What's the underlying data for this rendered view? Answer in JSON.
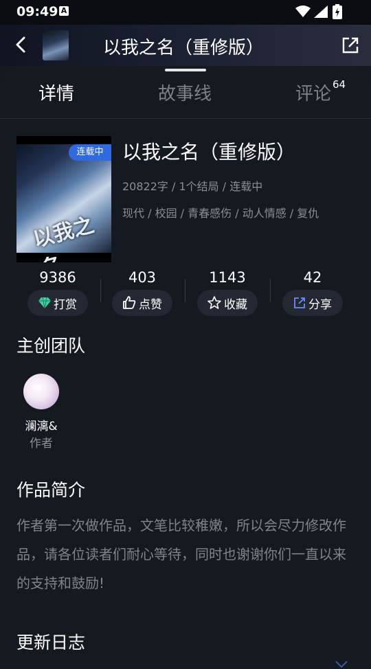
{
  "status_bar": {
    "time": "09:49",
    "a_icon": "A"
  },
  "header": {
    "title": "以我之名（重修版）"
  },
  "tabs": [
    {
      "label": "详情",
      "active": true
    },
    {
      "label": "故事线"
    },
    {
      "label": "评论",
      "badge": "64"
    }
  ],
  "book": {
    "cover_text": "以我之名",
    "status_tag": "连载中",
    "title": "以我之名（重修版）",
    "meta": "20822字 / 1个结局 / 连载中",
    "tags": "现代 / 校园 / 青春感伤 / 动人情感 / 复仇"
  },
  "stats": [
    {
      "count": "9386",
      "label": "打赏",
      "icon": "diamond-icon"
    },
    {
      "count": "403",
      "label": "点赞",
      "icon": "thumbs-up-icon"
    },
    {
      "count": "1143",
      "label": "收藏",
      "icon": "star-icon"
    },
    {
      "count": "42",
      "label": "分享",
      "icon": "share-icon"
    }
  ],
  "team": {
    "title": "主创团队",
    "members": [
      {
        "name": "澜漓&",
        "role": "作者"
      }
    ]
  },
  "intro": {
    "title": "作品简介",
    "text": "作者第一次做作品，文笔比较稚嫩，所以会尽力修改作品，请各位读者们耐心等待，同时也谢谢你们一直以来的支持和鼓励!"
  },
  "changelog": {
    "title": "更新日志"
  },
  "colors": {
    "background": "#151920",
    "accent": "#2f6ae0",
    "diamond": "#3fd0a0",
    "share": "#6e8cff"
  }
}
